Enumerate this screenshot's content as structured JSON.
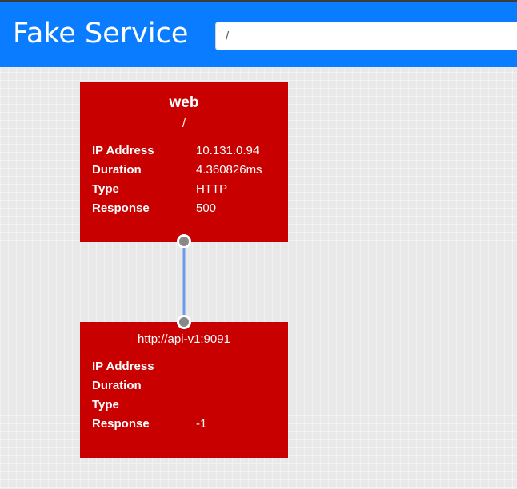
{
  "header": {
    "title": "Fake Service",
    "url_value": "/"
  },
  "nodes": [
    {
      "name": "web",
      "path": "/",
      "fields": [
        {
          "label": "IP Address",
          "value": "10.131.0.94"
        },
        {
          "label": "Duration",
          "value": "4.360826ms"
        },
        {
          "label": "Type",
          "value": "HTTP"
        },
        {
          "label": "Response",
          "value": "500"
        }
      ]
    },
    {
      "uri": "http://api-v1:9091",
      "fields": [
        {
          "label": "IP Address",
          "value": ""
        },
        {
          "label": "Duration",
          "value": ""
        },
        {
          "label": "Type",
          "value": ""
        },
        {
          "label": "Response",
          "value": "-1"
        }
      ]
    }
  ],
  "colors": {
    "header": "#0a7cff",
    "node_error": "#c80000",
    "connector": "#6c9bea",
    "port": "#888888"
  }
}
